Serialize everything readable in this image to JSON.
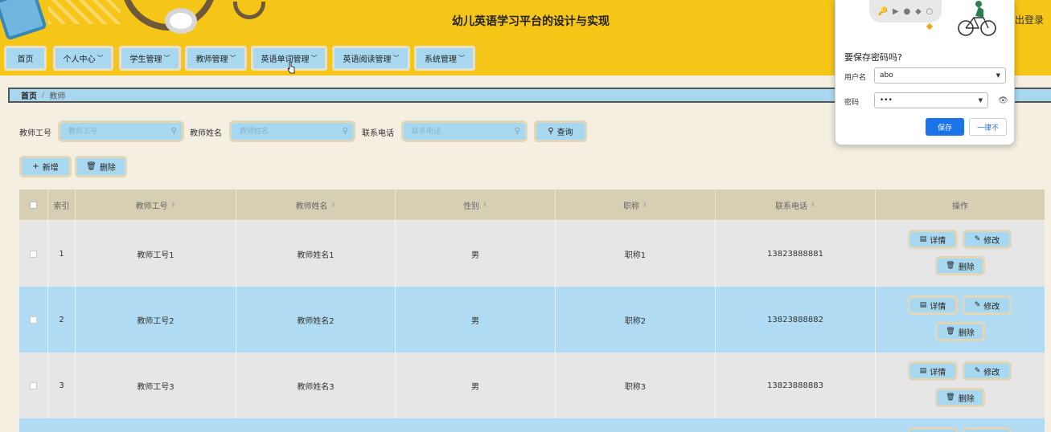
{
  "header": {
    "title": "幼儿英语学习平台的设计与实现",
    "logout_label": "出登录"
  },
  "nav": {
    "items": [
      {
        "label": "首页",
        "dropdown": false
      },
      {
        "label": "个人中心",
        "dropdown": true
      },
      {
        "label": "学生管理",
        "dropdown": true
      },
      {
        "label": "教师管理",
        "dropdown": true
      },
      {
        "label": "英语单词管理",
        "dropdown": true
      },
      {
        "label": "英语阅读管理",
        "dropdown": true
      },
      {
        "label": "系统管理",
        "dropdown": true
      }
    ]
  },
  "breadcrumb": {
    "home": "首页",
    "separator": "/",
    "current": "教师"
  },
  "search": {
    "fields": [
      {
        "label": "教师工号",
        "placeholder": "教师工号"
      },
      {
        "label": "教师姓名",
        "placeholder": "教师姓名"
      },
      {
        "label": "联系电话",
        "placeholder": "联系电话"
      }
    ],
    "query_label": "查询"
  },
  "actions": {
    "add_label": "新增",
    "delete_label": "删除"
  },
  "table": {
    "columns": [
      "索引",
      "教师工号",
      "教师姓名",
      "性别",
      "职称",
      "联系电话",
      "操作"
    ],
    "rows": [
      {
        "index": "1",
        "teacher_id": "教师工号1",
        "teacher_name": "教师姓名1",
        "gender": "男",
        "title": "职称1",
        "phone": "13823888881"
      },
      {
        "index": "2",
        "teacher_id": "教师工号2",
        "teacher_name": "教师姓名2",
        "gender": "男",
        "title": "职称2",
        "phone": "13823888882"
      },
      {
        "index": "3",
        "teacher_id": "教师工号3",
        "teacher_name": "教师姓名3",
        "gender": "男",
        "title": "职称3",
        "phone": "13823888883"
      }
    ],
    "row_actions": {
      "detail": "详情",
      "edit": "修改",
      "delete": "删除"
    }
  },
  "password_popup": {
    "title": "要保存密码吗?",
    "username_label": "用户名",
    "username_value": "abo",
    "password_label": "密码",
    "password_value": "•••",
    "save_label": "保存",
    "never_label": "一律不"
  },
  "colors": {
    "header_bg": "#f5c518",
    "button_bg": "#a8d8f0",
    "row_alt_bg": "#b0dbf3",
    "primary_blue": "#1a73e8"
  }
}
